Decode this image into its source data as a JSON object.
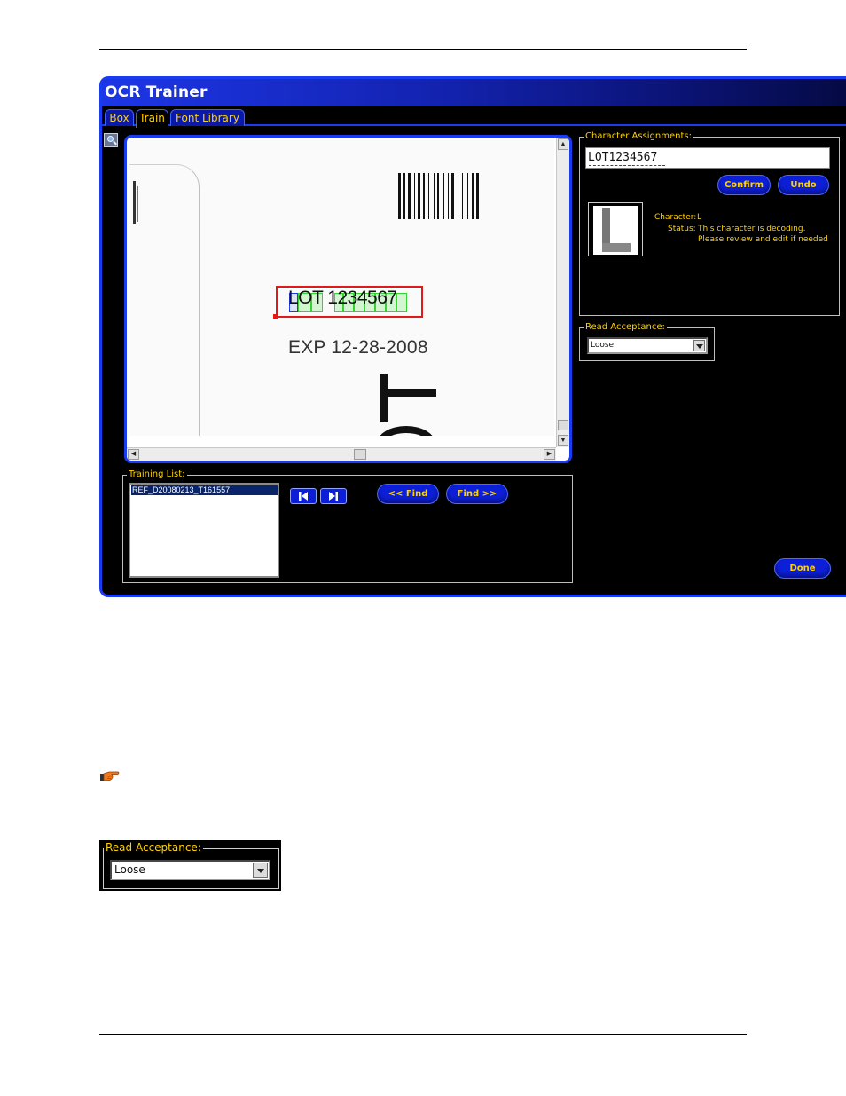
{
  "window": {
    "title": "OCR Trainer",
    "tabs": [
      {
        "label": "Box",
        "active": false
      },
      {
        "label": "Train",
        "active": true
      },
      {
        "label": "Font Library",
        "active": false
      }
    ]
  },
  "viewer": {
    "image": {
      "ocr_text": "LOT 1234567",
      "expiry_text": "EXP 12-28-2008"
    }
  },
  "training_list": {
    "label": "Training List:",
    "items": [
      "REF_D20080213_T161557"
    ],
    "first_label": "",
    "last_label": "",
    "find_prev_label": "<< Find",
    "find_next_label": "Find >>"
  },
  "character_assignments": {
    "label": "Character Assignments:",
    "value": "LOT1234567",
    "confirm_label": "Confirm",
    "undo_label": "Undo",
    "character_prefix": "Character:",
    "character_value": "L",
    "status_prefix": "Status:",
    "status_line1": "This character is decoding.",
    "status_line2": "Please review and edit if needed"
  },
  "read_acceptance": {
    "label": "Read Acceptance:",
    "value": "Loose"
  },
  "done_label": "Done",
  "colors": {
    "accent_blue": "#1a3cf0",
    "label_yellow": "#ffd200",
    "box_red": "#e01a1a",
    "char_green": "#36d431"
  },
  "icons": {
    "zoom": "magnifier-icon",
    "pointer": "pointing-hand-icon"
  }
}
